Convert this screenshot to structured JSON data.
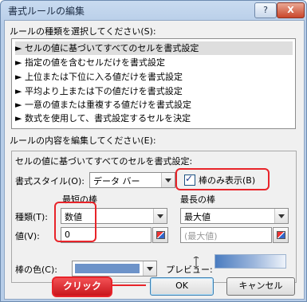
{
  "window": {
    "title": "書式ルールの編集",
    "help_glyph": "?",
    "close_glyph": "X"
  },
  "rule_type": {
    "label": "ルールの種類を選択してください(S):",
    "items": [
      "► セルの値に基づいてすべてのセルを書式設定",
      "► 指定の値を含むセルだけを書式設定",
      "► 上位または下位に入る値だけを書式設定",
      "► 平均より上または下の値だけを書式設定",
      "► 一意の値または重複する値だけを書式設定",
      "► 数式を使用して、書式設定するセルを決定"
    ],
    "selected_index": 0
  },
  "rule_content": {
    "label": "ルールの内容を編集してください(E):",
    "group_title": "セルの値に基づいてすべてのセルを書式設定:",
    "format_style_label": "書式スタイル(O):",
    "format_style_value": "データ バー",
    "show_bar_only_label": "棒のみ表示(B)",
    "show_bar_only_checked": true,
    "check_glyph": "✓",
    "shortest_bar_label": "最短の棒",
    "longest_bar_label": "最長の棒",
    "type_label": "種類(T):",
    "value_label": "値(V):",
    "shortest_type": "数値",
    "shortest_value": "0",
    "longest_type": "最大値",
    "longest_value": "(最大値)",
    "bar_color_label": "棒の色(C):",
    "bar_color": "#6d93c9",
    "preview_label": "プレビュー:"
  },
  "buttons": {
    "ok": "OK",
    "cancel": "キャンセル"
  },
  "annotation": {
    "callout_text": "クリック",
    "color": "#e8242a"
  }
}
